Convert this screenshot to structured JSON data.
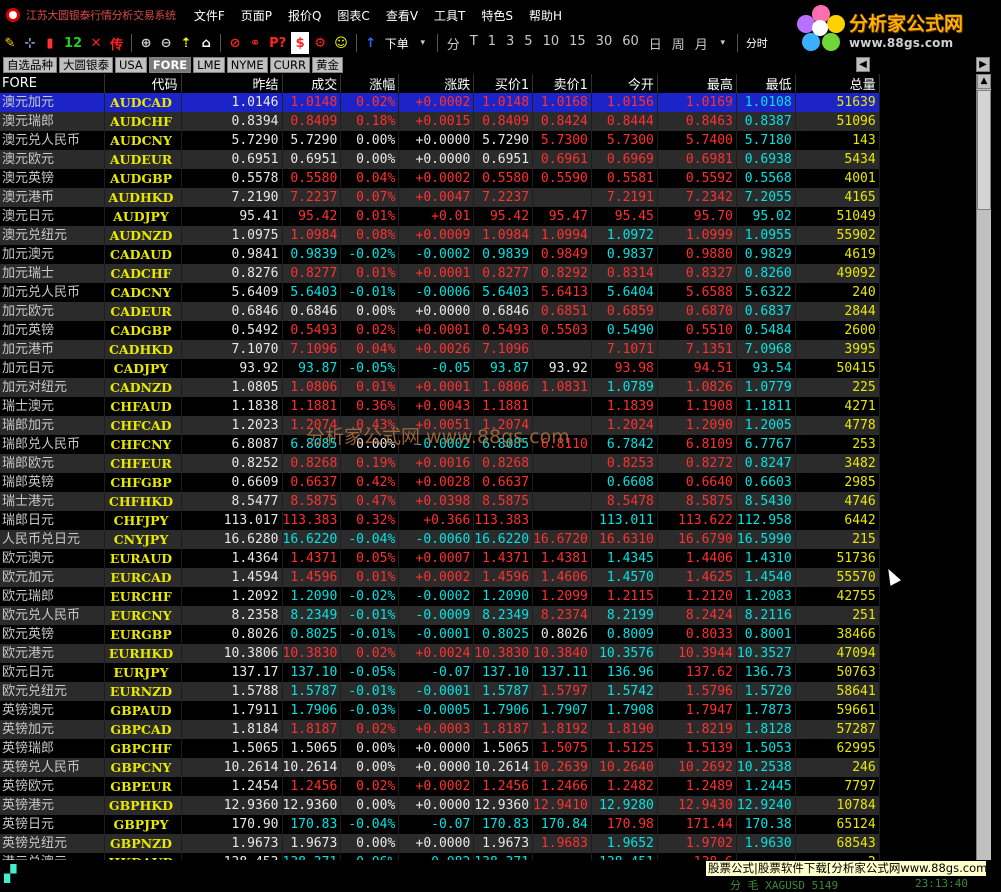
{
  "window": {
    "title": "江苏大圆银泰行情分析交易系统"
  },
  "menu": [
    {
      "label": "文件F",
      "name": "menu-file"
    },
    {
      "label": "页面P",
      "name": "menu-page"
    },
    {
      "label": "报价Q",
      "name": "menu-quote"
    },
    {
      "label": "图表C",
      "name": "menu-chart"
    },
    {
      "label": "查看V",
      "name": "menu-view"
    },
    {
      "label": "工具T",
      "name": "menu-tools"
    },
    {
      "label": "特色S",
      "name": "menu-special"
    },
    {
      "label": "帮助H",
      "name": "menu-help"
    }
  ],
  "toolbar": {
    "num_label": "12",
    "order_label": "下单",
    "periods": [
      "分",
      "T",
      "1",
      "3",
      "5",
      "10",
      "15",
      "30",
      "60",
      "日",
      "周",
      "月"
    ],
    "right_label": "分时"
  },
  "logo": {
    "cn": "分析家公式网",
    "url": "www.88gs.com"
  },
  "tabs": [
    {
      "label": "自选品种",
      "active": false
    },
    {
      "label": "大圆银泰",
      "active": false
    },
    {
      "label": "USA",
      "active": false
    },
    {
      "label": "FORE",
      "active": true
    },
    {
      "label": "LME",
      "active": false
    },
    {
      "label": "NYME",
      "active": false
    },
    {
      "label": "CURR",
      "active": false
    },
    {
      "label": "黄金",
      "active": false
    }
  ],
  "columns": [
    "FORE",
    "代码",
    "昨结",
    "成交",
    "涨幅",
    "涨跌",
    "买价1",
    "卖价1",
    "今开",
    "最高",
    "最低",
    "总量"
  ],
  "rows": [
    [
      "澳元加元",
      "AUDCAD",
      "1.0146",
      "1.0148",
      "0.02%",
      "+0.0002",
      "1.0148",
      "1.0168",
      "1.0156",
      "1.0169",
      "1.0108",
      "51639"
    ],
    [
      "澳元瑞郎",
      "AUDCHF",
      "0.8394",
      "0.8409",
      "0.18%",
      "+0.0015",
      "0.8409",
      "0.8424",
      "0.8444",
      "0.8463",
      "0.8387",
      "51096"
    ],
    [
      "澳元兑人民币",
      "AUDCNY",
      "5.7290",
      "5.7290",
      "0.00%",
      "+0.0000",
      "5.7290",
      "5.7300",
      "5.7300",
      "5.7400",
      "5.7180",
      "143"
    ],
    [
      "澳元欧元",
      "AUDEUR",
      "0.6951",
      "0.6951",
      "0.00%",
      "+0.0000",
      "0.6951",
      "0.6961",
      "0.6969",
      "0.6981",
      "0.6938",
      "5434"
    ],
    [
      "澳元英镑",
      "AUDGBP",
      "0.5578",
      "0.5580",
      "0.04%",
      "+0.0002",
      "0.5580",
      "0.5590",
      "0.5581",
      "0.5592",
      "0.5568",
      "4001"
    ],
    [
      "澳元港币",
      "AUDHKD",
      "7.2190",
      "7.2237",
      "0.07%",
      "+0.0047",
      "7.2237",
      "",
      "7.2191",
      "7.2342",
      "7.2055",
      "4165"
    ],
    [
      "澳元日元",
      "AUDJPY",
      "95.41",
      "95.42",
      "0.01%",
      "+0.01",
      "95.42",
      "95.47",
      "95.45",
      "95.70",
      "95.02",
      "51049"
    ],
    [
      "澳元兑纽元",
      "AUDNZD",
      "1.0975",
      "1.0984",
      "0.08%",
      "+0.0009",
      "1.0984",
      "1.0994",
      "1.0972",
      "1.0999",
      "1.0955",
      "55902"
    ],
    [
      "加元澳元",
      "CADAUD",
      "0.9841",
      "0.9839",
      "-0.02%",
      "-0.0002",
      "0.9839",
      "0.9849",
      "0.9837",
      "0.9880",
      "0.9829",
      "4619"
    ],
    [
      "加元瑞士",
      "CADCHF",
      "0.8276",
      "0.8277",
      "0.01%",
      "+0.0001",
      "0.8277",
      "0.8292",
      "0.8314",
      "0.8327",
      "0.8260",
      "49092"
    ],
    [
      "加元兑人民币",
      "CADCNY",
      "5.6409",
      "5.6403",
      "-0.01%",
      "-0.0006",
      "5.6403",
      "5.6413",
      "5.6404",
      "5.6588",
      "5.6322",
      "240"
    ],
    [
      "加元欧元",
      "CADEUR",
      "0.6846",
      "0.6846",
      "0.00%",
      "+0.0000",
      "0.6846",
      "0.6851",
      "0.6859",
      "0.6870",
      "0.6837",
      "2844"
    ],
    [
      "加元英镑",
      "CADGBP",
      "0.5492",
      "0.5493",
      "0.02%",
      "+0.0001",
      "0.5493",
      "0.5503",
      "0.5490",
      "0.5510",
      "0.5484",
      "2600"
    ],
    [
      "加元港币",
      "CADHKD",
      "7.1070",
      "7.1096",
      "0.04%",
      "+0.0026",
      "7.1096",
      "",
      "7.1071",
      "7.1351",
      "7.0968",
      "3995"
    ],
    [
      "加元日元",
      "CADJPY",
      "93.92",
      "93.87",
      "-0.05%",
      "-0.05",
      "93.87",
      "93.92",
      "93.98",
      "94.51",
      "93.54",
      "50415"
    ],
    [
      "加元对纽元",
      "CADNZD",
      "1.0805",
      "1.0806",
      "0.01%",
      "+0.0001",
      "1.0806",
      "1.0831",
      "1.0789",
      "1.0826",
      "1.0779",
      "225"
    ],
    [
      "瑞士澳元",
      "CHFAUD",
      "1.1838",
      "1.1881",
      "0.36%",
      "+0.0043",
      "1.1881",
      "",
      "1.1839",
      "1.1908",
      "1.1811",
      "4271"
    ],
    [
      "瑞郎加元",
      "CHFCAD",
      "1.2023",
      "1.2074",
      "0.43%",
      "+0.0051",
      "1.2074",
      "",
      "1.2024",
      "1.2090",
      "1.2005",
      "4778"
    ],
    [
      "瑞郎兑人民币",
      "CHFCNY",
      "6.8087",
      "6.8085",
      "0.00%",
      "-0.0002",
      "6.8085",
      "6.8110",
      "6.7842",
      "6.8109",
      "6.7767",
      "253"
    ],
    [
      "瑞郎欧元",
      "CHFEUR",
      "0.8252",
      "0.8268",
      "0.19%",
      "+0.0016",
      "0.8268",
      "",
      "0.8253",
      "0.8272",
      "0.8247",
      "3482"
    ],
    [
      "瑞郎英镑",
      "CHFGBP",
      "0.6609",
      "0.6637",
      "0.42%",
      "+0.0028",
      "0.6637",
      "",
      "0.6608",
      "0.6640",
      "0.6603",
      "2985"
    ],
    [
      "瑞士港元",
      "CHFHKD",
      "8.5477",
      "8.5875",
      "0.47%",
      "+0.0398",
      "8.5875",
      "",
      "8.5478",
      "8.5875",
      "8.5430",
      "4746"
    ],
    [
      "瑞郎日元",
      "CHFJPY",
      "113.017",
      "113.383",
      "0.32%",
      "+0.366",
      "113.383",
      "",
      "113.011",
      "113.622",
      "112.958",
      "6442"
    ],
    [
      "人民币兑日元",
      "CNYJPY",
      "16.6280",
      "16.6220",
      "-0.04%",
      "-0.0060",
      "16.6220",
      "16.6720",
      "16.6310",
      "16.6790",
      "16.5990",
      "215"
    ],
    [
      "欧元澳元",
      "EURAUD",
      "1.4364",
      "1.4371",
      "0.05%",
      "+0.0007",
      "1.4371",
      "1.4381",
      "1.4345",
      "1.4406",
      "1.4310",
      "51736"
    ],
    [
      "欧元加元",
      "EURCAD",
      "1.4594",
      "1.4596",
      "0.01%",
      "+0.0002",
      "1.4596",
      "1.4606",
      "1.4570",
      "1.4625",
      "1.4540",
      "55570"
    ],
    [
      "欧元瑞郎",
      "EURCHF",
      "1.2092",
      "1.2090",
      "-0.02%",
      "-0.0002",
      "1.2090",
      "1.2099",
      "1.2115",
      "1.2120",
      "1.2083",
      "42755"
    ],
    [
      "欧元兑人民币",
      "EURCNY",
      "8.2358",
      "8.2349",
      "-0.01%",
      "-0.0009",
      "8.2349",
      "8.2374",
      "8.2199",
      "8.2424",
      "8.2116",
      "251"
    ],
    [
      "欧元英镑",
      "EURGBP",
      "0.8026",
      "0.8025",
      "-0.01%",
      "-0.0001",
      "0.8025",
      "0.8026",
      "0.8009",
      "0.8033",
      "0.8001",
      "38466"
    ],
    [
      "欧元港元",
      "EURHKD",
      "10.3806",
      "10.3830",
      "0.02%",
      "+0.0024",
      "10.3830",
      "10.3840",
      "10.3576",
      "10.3944",
      "10.3527",
      "47094"
    ],
    [
      "欧元日元",
      "EURJPY",
      "137.17",
      "137.10",
      "-0.05%",
      "-0.07",
      "137.10",
      "137.11",
      "136.96",
      "137.62",
      "136.73",
      "50763"
    ],
    [
      "欧元兑纽元",
      "EURNZD",
      "1.5788",
      "1.5787",
      "-0.01%",
      "-0.0001",
      "1.5787",
      "1.5797",
      "1.5742",
      "1.5796",
      "1.5720",
      "58641"
    ],
    [
      "英镑澳元",
      "GBPAUD",
      "1.7911",
      "1.7906",
      "-0.03%",
      "-0.0005",
      "1.7906",
      "1.7907",
      "1.7908",
      "1.7947",
      "1.7873",
      "59661"
    ],
    [
      "英镑加元",
      "GBPCAD",
      "1.8184",
      "1.8187",
      "0.02%",
      "+0.0003",
      "1.8187",
      "1.8192",
      "1.8190",
      "1.8219",
      "1.8128",
      "57287"
    ],
    [
      "英镑瑞郎",
      "GBPCHF",
      "1.5065",
      "1.5065",
      "0.00%",
      "+0.0000",
      "1.5065",
      "1.5075",
      "1.5125",
      "1.5139",
      "1.5053",
      "62995"
    ],
    [
      "英镑兑人民币",
      "GBPCNY",
      "10.2614",
      "10.2614",
      "0.00%",
      "+0.0000",
      "10.2614",
      "10.2639",
      "10.2640",
      "10.2692",
      "10.2538",
      "246"
    ],
    [
      "英镑欧元",
      "GBPEUR",
      "1.2454",
      "1.2456",
      "0.02%",
      "+0.0002",
      "1.2456",
      "1.2466",
      "1.2482",
      "1.2489",
      "1.2445",
      "7797"
    ],
    [
      "英镑港元",
      "GBPHKD",
      "12.9360",
      "12.9360",
      "0.00%",
      "+0.0000",
      "12.9360",
      "12.9410",
      "12.9280",
      "12.9430",
      "12.9240",
      "10784"
    ],
    [
      "英镑日元",
      "GBPJPY",
      "170.90",
      "170.83",
      "-0.04%",
      "-0.07",
      "170.83",
      "170.84",
      "170.98",
      "171.44",
      "170.38",
      "65124"
    ],
    [
      "英镑兑纽元",
      "GBPNZD",
      "1.9673",
      "1.9673",
      "0.00%",
      "+0.0000",
      "1.9673",
      "1.9683",
      "1.9652",
      "1.9702",
      "1.9630",
      "68543"
    ],
    [
      "港元兑澳元",
      "HKDAUD",
      "138.453",
      "138.371",
      "-0.06%",
      "-0.082",
      "138.371",
      "",
      "138.451",
      "138.6",
      "",
      "2"
    ]
  ],
  "selected_row": 0,
  "overlay_watermark": "分析家公式网 www.88gs.com",
  "status": {
    "banner": "股票公式|股票软件下载[分析家公式网www.88gs.com]",
    "text": "分  毛 XAGUSD 5149",
    "time": "23:13:40"
  },
  "colors": {
    "up": "#ff3030",
    "down": "#00e4e4",
    "flat": "#e8e8e8",
    "code": "#e8e800",
    "selected_bg": "#1c24c8",
    "alt_row_bg": "#2b2b2b"
  }
}
